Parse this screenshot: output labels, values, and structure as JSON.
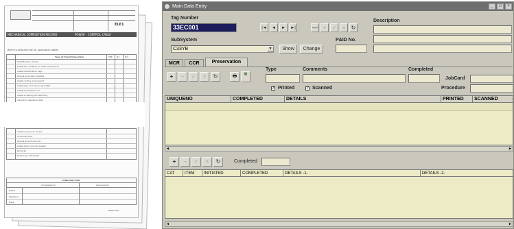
{
  "window": {
    "title": "Main Data Entry",
    "controls": [
      "_",
      "□",
      "×"
    ]
  },
  "tag": {
    "label": "Tag Number",
    "value": "33EC001"
  },
  "nav_buttons": [
    "|◄",
    "◄",
    "►",
    "►|",
    "—",
    "+",
    "✓",
    "×",
    "↻"
  ],
  "description": {
    "label": "Description"
  },
  "subsystem": {
    "label": "SubSystem",
    "value": "C33YB",
    "show_label": "Show",
    "change_label": "Change"
  },
  "pid": {
    "label": "P&ID No."
  },
  "tabs": [
    {
      "label": "MCR",
      "active": false
    },
    {
      "label": "CCR",
      "active": false
    },
    {
      "label": "Preservation",
      "active": true
    }
  ],
  "preservation": {
    "type_label": "Type",
    "comments_label": "Comments",
    "completed_label": "Completed",
    "jobcard_label": "JobCard",
    "procedure_label": "Procedure",
    "printed_label": "Printed",
    "scanned_label": "Scanned",
    "printed_checked": true,
    "scanned_checked": true
  },
  "upper_grid": {
    "columns": [
      "UNIQUENO",
      "COMPLETED",
      "DETAILS",
      "PRINTED",
      "SCANNED"
    ]
  },
  "lower": {
    "completed_label": "Completed",
    "columns": [
      "CAT",
      "ITEM",
      "INITIATED",
      "COMPLETED",
      "DETAILS -1-",
      "DETAILS -2-"
    ]
  },
  "paper": {
    "header_left": "MECHANICAL COMPLETION RECORD",
    "header_right": "POWER - CONTROL CABLE",
    "code": "ELE1",
    "section_title": "Type of Check/Inspection",
    "col_headers": [
      "PRE",
      "NA",
      "N/A"
    ],
    "instruction": "Refer to attached list for applicable cables",
    "rows": [
      "Identification checks",
      "Cable fan condition to cable schedule ok",
      "Cable identification tags",
      "Glands and seals installed",
      "Cable routing and support",
      "Cable type and size as specified",
      "Cable terminations ok",
      "Cable screening and earthing",
      "Insulation resistance test"
    ],
    "lower_rows": [
      "Cable to ground / screen",
      "Continuity test",
      "Glands and shrouds ok",
      "Cable ends correctly sealed",
      "Remarks",
      "Tested by / witnessed"
    ],
    "footer_title": "CONSTRUCTION",
    "footer_cols": [
      "Completed by",
      "Approved by"
    ],
    "footer_rows": [
      "Name",
      "Signature",
      "Date"
    ],
    "form_ref": "FORM ELE1"
  }
}
